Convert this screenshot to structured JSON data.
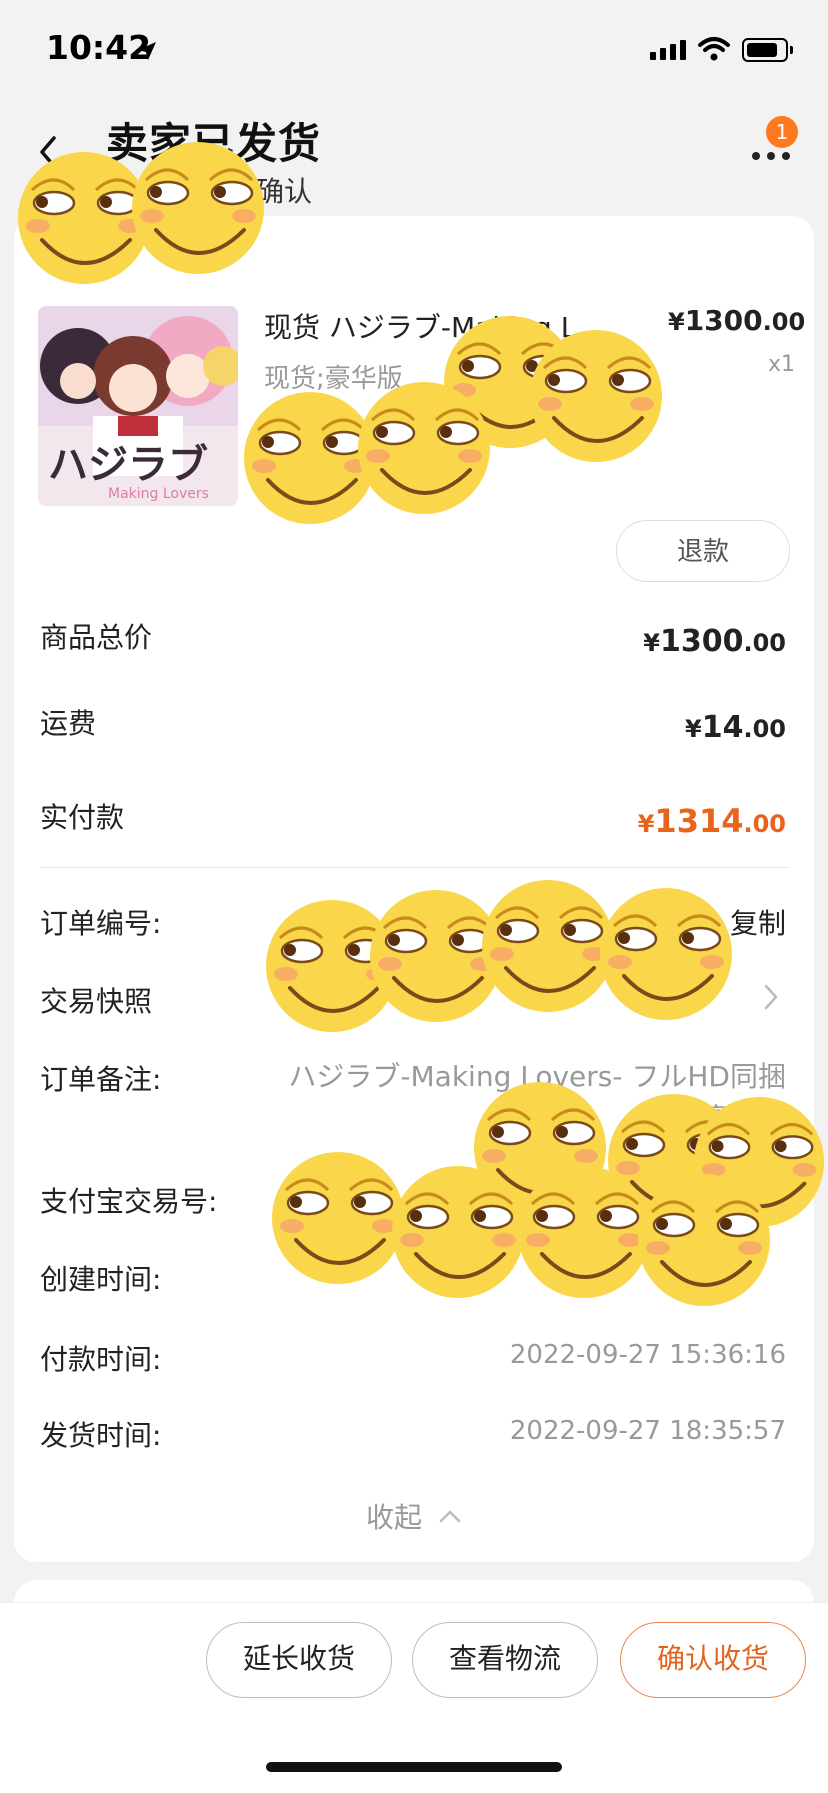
{
  "status_bar": {
    "time": "10:42"
  },
  "header": {
    "title": "卖家已发货",
    "subtitle_fragment": "自动确认",
    "more_badge_count": "1"
  },
  "product": {
    "title": "现货 ハジラブ-Making L...",
    "spec": "现货;豪华版",
    "price_symbol": "¥",
    "price_int": "1300",
    "price_dec": ".00",
    "quantity": "x1",
    "refund_label": "退款"
  },
  "summary": {
    "goods_total_label": "商品总价",
    "goods_total": {
      "sym": "¥",
      "int": "1300",
      "dec": ".00"
    },
    "shipping_label": "运费",
    "shipping": {
      "sym": "¥",
      "int": "14",
      "dec": ".00"
    },
    "paid_label": "实付款",
    "paid": {
      "sym": "¥",
      "int": "1314",
      "dec": ".00"
    }
  },
  "order": {
    "order_no_label": "订单编号:",
    "copy_label": "复制",
    "snapshot_label": "交易快照",
    "note_label": "订单备注:",
    "note_value": "ハジラブ-Making Lovers- フルHD同捆豪华版",
    "alipay_label": "支付宝交易号:",
    "created_label": "创建时间:",
    "paid_time_label": "付款时间:",
    "paid_time_value": "2022-09-27 15:36:16",
    "shipped_label": "发货时间:",
    "shipped_value": "2022-09-27 18:35:57",
    "collapse_label": "收起"
  },
  "bottom_bar": {
    "extend_label": "延长收货",
    "logistics_label": "查看物流",
    "confirm_label": "确认收货"
  },
  "colors": {
    "accent_orange": "#e8641c",
    "badge_orange": "#ff7a1e",
    "sticker_yellow": "#f9d64a"
  }
}
